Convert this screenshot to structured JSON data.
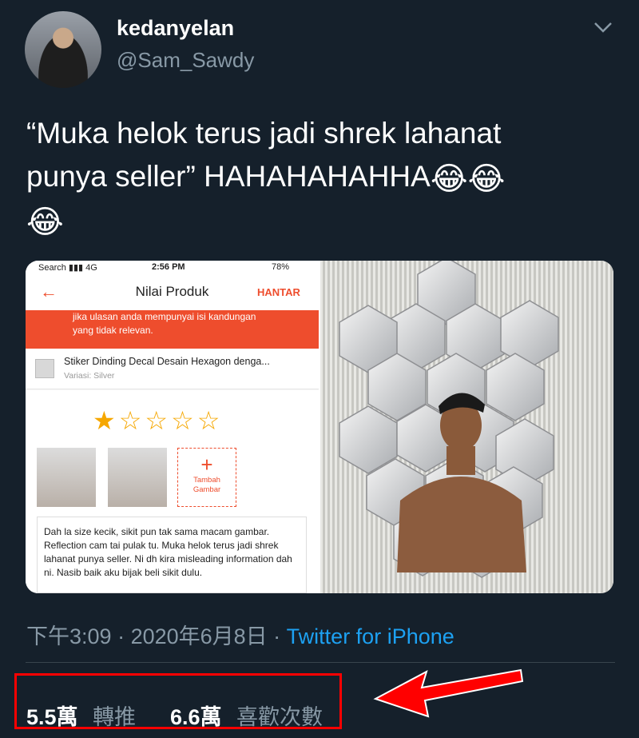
{
  "author": {
    "display_name": "kedanyelan",
    "handle": "@Sam_Sawdy"
  },
  "tweet": {
    "text_line1": "“Muka helok terus jadi shrek lahanat",
    "text_line2": "punya seller” HAHAHAHAHHA",
    "emojis": "😂😂",
    "emoji_line3": "😂"
  },
  "media": {
    "screenshot": {
      "status_left": "Search ▮▮▮ 4G",
      "status_time": "2:56 PM",
      "status_battery": "78%",
      "back_icon": "←",
      "title": "Nilai Produk",
      "submit": "HANTAR",
      "banner_line1": "jika ulasan anda mempunyai isi kandungan",
      "banner_line2": "yang tidak relevan.",
      "product_name": "Stiker Dinding Decal Desain Hexagon denga...",
      "product_variant": "Variasi: Silver",
      "stars_filled": "★",
      "stars_empty": "☆☆☆☆",
      "rating": 1,
      "add_photo_plus": "+",
      "add_photo_line1": "Tambah",
      "add_photo_line2": "Gambar",
      "review_text": "Dah la size kecik, sikit pun tak sama macam gambar. Reflection cam tai pulak tu. Muka helok terus jadi shrek lahanat punya seller. Ni dh kira misleading information dah ni. Nasib baik aku bijak beli sikit dulu."
    }
  },
  "meta": {
    "time": "下午3:09",
    "dot1": " · ",
    "date": "2020年6月8日",
    "dot2": " · ",
    "source": "Twitter for iPhone"
  },
  "stats": {
    "retweets_count": "5.5萬",
    "retweets_label": "轉推",
    "likes_count": "6.6萬",
    "likes_label": "喜歡次數"
  },
  "colors": {
    "background": "#15202b",
    "secondary_text": "#8899a6",
    "link": "#1da1f2",
    "highlight": "#ff0000",
    "shopee_orange": "#ee4d2d"
  }
}
